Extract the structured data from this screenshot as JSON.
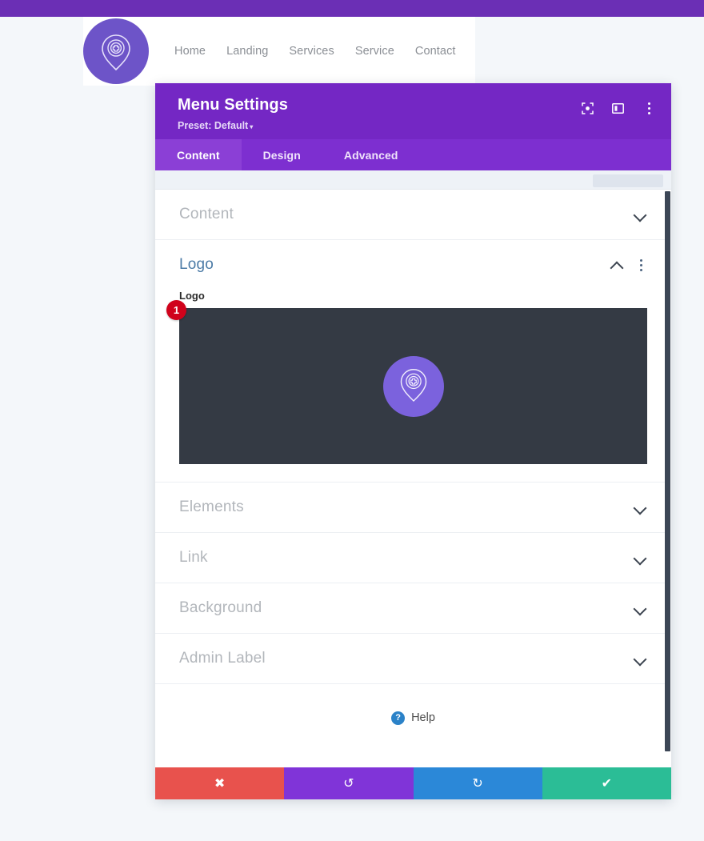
{
  "site": {
    "logo_icon": "map-pin-gear-icon",
    "nav": [
      {
        "label": "Home"
      },
      {
        "label": "Landing"
      },
      {
        "label": "Services"
      },
      {
        "label": "Service"
      },
      {
        "label": "Contact"
      }
    ]
  },
  "modal": {
    "title": "Menu Settings",
    "preset_label": "Preset: Default",
    "preset_caret": "▾",
    "header_icons": [
      {
        "name": "focus-target-icon"
      },
      {
        "name": "layout-panel-icon"
      },
      {
        "name": "more-options-icon"
      }
    ],
    "tabs": [
      {
        "label": "Content",
        "active": true
      },
      {
        "label": "Design",
        "active": false
      },
      {
        "label": "Advanced",
        "active": false
      }
    ],
    "sections": [
      {
        "label": "Content",
        "open": false
      },
      {
        "label": "Logo",
        "open": true
      },
      {
        "label": "Elements",
        "open": false
      },
      {
        "label": "Link",
        "open": false
      },
      {
        "label": "Background",
        "open": false
      },
      {
        "label": "Admin Label",
        "open": false
      }
    ],
    "logo_field": {
      "label": "Logo",
      "badge_count": "1",
      "preview_icon": "map-pin-gear-icon"
    },
    "help": {
      "icon_glyph": "?",
      "label": "Help"
    },
    "footer": [
      {
        "name": "cancel-button",
        "glyph": "✖"
      },
      {
        "name": "undo-button",
        "glyph": "↺"
      },
      {
        "name": "redo-button",
        "glyph": "↻"
      },
      {
        "name": "save-button",
        "glyph": "✔"
      }
    ]
  },
  "colors": {
    "topbar_purple": "#6b2fb5",
    "header_purple": "#7427c4",
    "tab_active_purple": "#8b3fd6",
    "section_active_blue": "#4c7ba6",
    "badge_red": "#d0021b",
    "cancel_red": "#e8524d",
    "undo_purple": "#8034d8",
    "redo_blue": "#2b88d8",
    "save_green": "#2bbd96",
    "upload_dark": "#343a44",
    "logo_purple": "#6d54c8"
  }
}
